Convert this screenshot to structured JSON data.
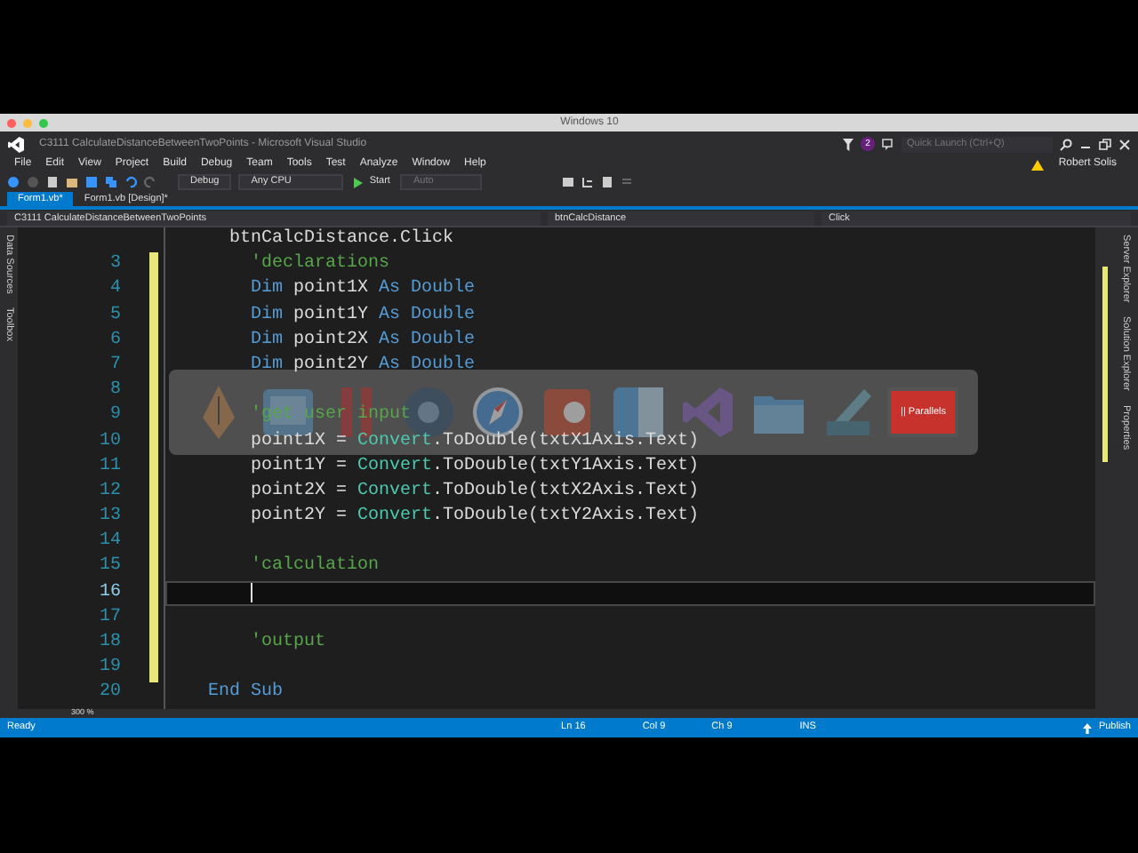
{
  "host_window": {
    "title": "Windows 10"
  },
  "window": {
    "title": "C3111 CalculateDistanceBetweenTwoPoints - Microsoft Visual Studio",
    "notifications": "2",
    "quick_launch": {
      "placeholder": "Quick Launch (Ctrl+Q)"
    },
    "user": "Robert Solis"
  },
  "menu": [
    "File",
    "Edit",
    "View",
    "Project",
    "Build",
    "Debug",
    "Team",
    "Tools",
    "Test",
    "Analyze",
    "Window",
    "Help"
  ],
  "toolbar": {
    "configuration": "Debug",
    "platform": "Any CPU",
    "start": "Start",
    "target": "Auto"
  },
  "tabs": [
    {
      "label": "Form1.vb*",
      "selected": true
    },
    {
      "label": "Form1.vb [Design]*",
      "selected": false
    }
  ],
  "navigation": {
    "project": "C3111 CalculateDistanceBetweenTwoPoints",
    "object": "btnCalcDistance",
    "member": "Click"
  },
  "left_panels": [
    "Data Sources",
    "Toolbox"
  ],
  "right_panels": [
    "Server Explorer",
    "Solution Explorer",
    "Properties"
  ],
  "editor": {
    "zoom": "300 %",
    "lines": [
      {
        "current": false,
        "tokens": [
          {
            "kind": "plain",
            "text": "  btnCalcDistance.Click"
          }
        ]
      },
      {
        "number": "3",
        "current": false,
        "tokens": [
          {
            "kind": "comment",
            "text": "    'declarations"
          }
        ]
      },
      {
        "number": "4",
        "current": false,
        "tokens": [
          {
            "kind": "keyword",
            "text": "    Dim"
          },
          {
            "kind": "plain",
            "text": " point1X "
          },
          {
            "kind": "keyword",
            "text": "As Double"
          }
        ]
      },
      {
        "number": "5",
        "current": false,
        "tokens": [
          {
            "kind": "keyword",
            "text": "    Dim"
          },
          {
            "kind": "plain",
            "text": " point1Y "
          },
          {
            "kind": "keyword",
            "text": "As Double"
          }
        ]
      },
      {
        "number": "6",
        "current": false,
        "tokens": [
          {
            "kind": "keyword",
            "text": "    Dim"
          },
          {
            "kind": "plain",
            "text": " point2X "
          },
          {
            "kind": "keyword",
            "text": "As Double"
          }
        ]
      },
      {
        "number": "7",
        "current": false,
        "tokens": [
          {
            "kind": "keyword",
            "text": "    Dim"
          },
          {
            "kind": "plain",
            "text": " point2Y "
          },
          {
            "kind": "keyword",
            "text": "As Double"
          }
        ]
      },
      {
        "number": "8",
        "current": false
      },
      {
        "number": "9",
        "current": false,
        "tokens": [
          {
            "kind": "comment",
            "text": "    'get user input"
          }
        ]
      },
      {
        "number": "10",
        "current": false,
        "tokens": [
          {
            "kind": "plain",
            "text": "    point1X = "
          },
          {
            "kind": "type",
            "text": "Convert"
          },
          {
            "kind": "plain",
            "text": ".ToDouble(txtX1Axis.Text)"
          }
        ]
      },
      {
        "number": "11",
        "current": false,
        "tokens": [
          {
            "kind": "plain",
            "text": "    point1Y = "
          },
          {
            "kind": "type",
            "text": "Convert"
          },
          {
            "kind": "plain",
            "text": ".ToDouble(txtY1Axis.Text)"
          }
        ]
      },
      {
        "number": "12",
        "current": false,
        "tokens": [
          {
            "kind": "plain",
            "text": "    point2X = "
          },
          {
            "kind": "type",
            "text": "Convert"
          },
          {
            "kind": "plain",
            "text": ".ToDouble(txtX2Axis.Text)"
          }
        ]
      },
      {
        "number": "13",
        "current": false,
        "tokens": [
          {
            "kind": "plain",
            "text": "    point2Y = "
          },
          {
            "kind": "type",
            "text": "Convert"
          },
          {
            "kind": "plain",
            "text": ".ToDouble(txtY2Axis.Text)"
          }
        ]
      },
      {
        "number": "14",
        "current": false
      },
      {
        "number": "15",
        "current": false,
        "tokens": [
          {
            "kind": "comment",
            "text": "    'calculation"
          }
        ]
      },
      {
        "number": "16",
        "current": true
      },
      {
        "number": "17",
        "current": false
      },
      {
        "number": "18",
        "current": false,
        "tokens": [
          {
            "kind": "comment",
            "text": "    'output"
          }
        ]
      },
      {
        "number": "19",
        "current": false
      },
      {
        "number": "20",
        "current": false,
        "tokens": [
          {
            "kind": "keyword",
            "text": "End Sub"
          }
        ]
      }
    ]
  },
  "dock": [
    {
      "kind": "pen"
    },
    {
      "kind": "photo"
    },
    {
      "kind": "bars"
    },
    {
      "kind": "globe"
    },
    {
      "kind": "compass"
    },
    {
      "kind": "slides"
    },
    {
      "kind": "finder"
    },
    {
      "kind": "ribbon"
    },
    {
      "kind": "folder"
    },
    {
      "kind": "preview"
    },
    {
      "kind": "tile",
      "label": "|| Parallels"
    }
  ],
  "status_bar": {
    "state": "Ready",
    "line": "Ln 16",
    "column": "Col 9",
    "char": "Ch 9",
    "mode": "INS",
    "publish": "Publish"
  }
}
